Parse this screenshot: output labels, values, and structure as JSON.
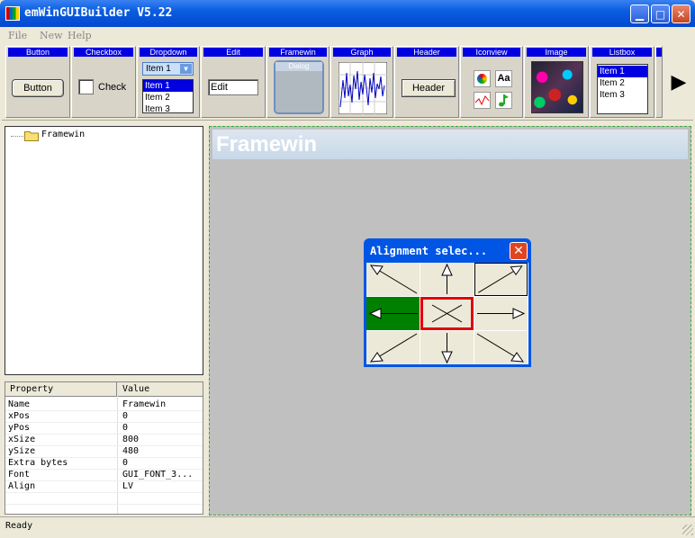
{
  "window": {
    "title": "emWinGUIBuilder V5.22"
  },
  "menu": [
    "File",
    "New",
    "Help"
  ],
  "toolbar": {
    "items": [
      "Button",
      "Checkbox",
      "Dropdown",
      "Edit",
      "Framewin",
      "Graph",
      "Header",
      "Iconview",
      "Image",
      "Listbox"
    ],
    "button_label": "Button",
    "checkbox_label": "Check",
    "dropdown_value": "Item 1",
    "dropdown_items": [
      "Item 1",
      "Item 2",
      "Item 3"
    ],
    "edit_value": "Edit",
    "framewin_caption": "Dialog",
    "header_label": "Header",
    "iconview_text_icon": "Aa",
    "listbox_items": [
      "Item 1",
      "Item 2",
      "Item 3"
    ]
  },
  "tree": {
    "root": "Framewin"
  },
  "properties": {
    "headers": [
      "Property",
      "Value"
    ],
    "rows": [
      {
        "name": "Name",
        "value": "Framewin"
      },
      {
        "name": "xPos",
        "value": "0"
      },
      {
        "name": "yPos",
        "value": "0"
      },
      {
        "name": "xSize",
        "value": "800"
      },
      {
        "name": "ySize",
        "value": "480"
      },
      {
        "name": "Extra bytes",
        "value": "0"
      },
      {
        "name": "Font",
        "value": "GUI_FONT_3..."
      },
      {
        "name": "Align",
        "value": "LV"
      }
    ]
  },
  "editor": {
    "framewin_title": "Framewin"
  },
  "dialog": {
    "title": "Alignment selec..."
  },
  "status": {
    "text": "Ready"
  },
  "colors": {
    "xp_blue": "#0055e5",
    "toolbar_head": "#0000e0",
    "selected_cell": "#008000",
    "focus_border": "#e00000"
  }
}
